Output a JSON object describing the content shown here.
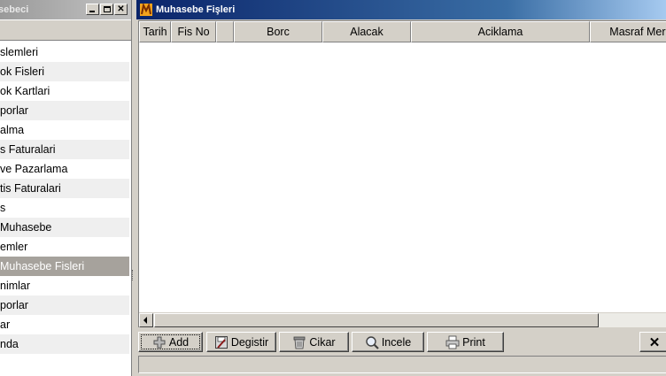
{
  "left_pane": {
    "title": "sebeci",
    "items": [
      {
        "label": "slemleri",
        "selected": false
      },
      {
        "label": "ok Fisleri",
        "selected": false
      },
      {
        "label": "ok Kartlari",
        "selected": false
      },
      {
        "label": "porlar",
        "selected": false
      },
      {
        "label": "alma",
        "selected": false
      },
      {
        "label": "s Faturalari",
        "selected": false
      },
      {
        "label": "ve Pazarlama",
        "selected": false
      },
      {
        "label": "tis Faturalari",
        "selected": false
      },
      {
        "label": "s",
        "selected": false
      },
      {
        "label": " Muhasebe",
        "selected": false
      },
      {
        "label": "emler",
        "selected": false
      },
      {
        "label": " Muhasebe Fisleri",
        "selected": true
      },
      {
        "label": "nimlar",
        "selected": false
      },
      {
        "label": "porlar",
        "selected": false
      },
      {
        "label": "ar",
        "selected": false
      },
      {
        "label": "nda",
        "selected": false
      }
    ]
  },
  "window": {
    "title": "Muhasebe Fişleri",
    "icon": "app-m-icon"
  },
  "grid": {
    "columns": [
      "Tarih",
      "Fis No",
      "",
      "Borc",
      "Alacak",
      "Aciklama",
      "Masraf Merkezi"
    ],
    "rows": []
  },
  "toolbar": {
    "add_label": "Add",
    "degistir_label": "Degistir",
    "cikar_label": "Cikar",
    "incele_label": "Incele",
    "print_label": "Print",
    "close_label": "✕"
  },
  "colors": {
    "title_active": "#0a246a",
    "title_inactive": "#9a9a9a",
    "selected_row": "#a6a29c",
    "face": "#d4d0c8"
  }
}
